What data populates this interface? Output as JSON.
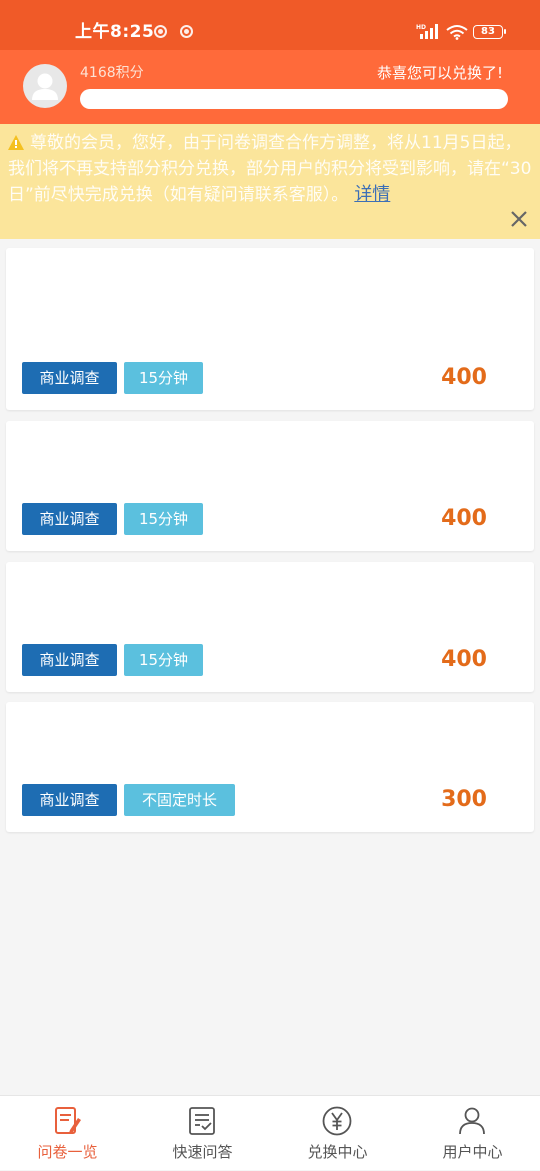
{
  "status_bar": {
    "time": "上午8:25",
    "network": "HD",
    "battery": "83"
  },
  "header": {
    "points": "4168积分",
    "message": "恭喜您可以兑换了!"
  },
  "notice": {
    "text": "尊敬的会员，您好，由于问卷调查合作方调整，将从11月5日起，我们将不再支持部分积分兑换，部分用户的积分将受到影响，请在“30日”前尽快完成兑换（如有疑问请联系客服）。",
    "link": "详情"
  },
  "surveys": [
    {
      "category": "商业调查",
      "duration": "15分钟",
      "points": "400"
    },
    {
      "category": "商业调查",
      "duration": "15分钟",
      "points": "400"
    },
    {
      "category": "商业调查",
      "duration": "15分钟",
      "points": "400"
    },
    {
      "category": "商业调查",
      "duration": "不固定时长",
      "points": "300"
    }
  ],
  "nav": [
    {
      "label": "问卷一览",
      "icon": "survey-list-icon",
      "active": true
    },
    {
      "label": "快速问答",
      "icon": "quick-answer-icon",
      "active": false
    },
    {
      "label": "兑换中心",
      "icon": "yen-circle-icon",
      "active": false
    },
    {
      "label": "用户中心",
      "icon": "user-icon",
      "active": false
    }
  ],
  "colors": {
    "status_bar": "#f05a28",
    "header": "#ff6a3a",
    "notice_bg": "#fbe59b",
    "category_tag": "#1e6db3",
    "duration_tag": "#5bc0de",
    "points": "#e36b1a",
    "active_nav": "#e8603c",
    "link": "#3d6fb6"
  }
}
